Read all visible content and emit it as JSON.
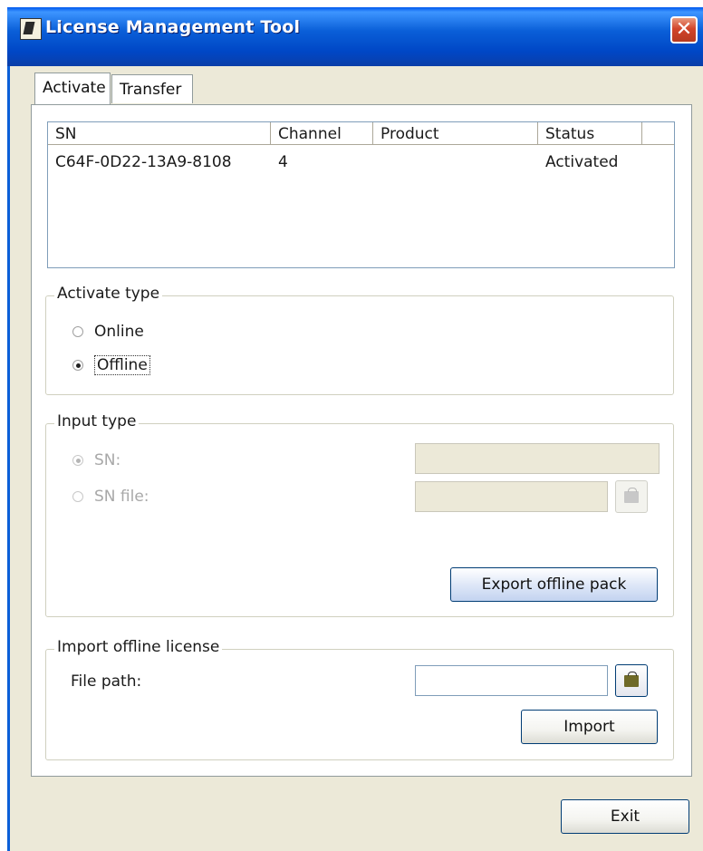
{
  "window": {
    "title": "License Management Tool",
    "close_glyph": "✕"
  },
  "tabs": [
    {
      "label": "Activate",
      "active": true
    },
    {
      "label": "Transfer",
      "active": false
    }
  ],
  "list": {
    "columns": [
      "SN",
      "Channel",
      "Product",
      "Status"
    ],
    "rows": [
      {
        "sn": "C64F-0D22-13A9-8108",
        "channel": "4",
        "product": "",
        "status": "Activated"
      }
    ]
  },
  "activate_type": {
    "label": "Activate type",
    "options": [
      {
        "label": "Online",
        "checked": false
      },
      {
        "label": "Offline",
        "checked": true
      }
    ]
  },
  "input_type": {
    "label": "Input type",
    "sn_label": "SN:",
    "sn_file_label": "SN file:",
    "sn_value": "",
    "sn_file_value": "",
    "export_button": "Export offline pack"
  },
  "import_license": {
    "label": "Import offline license",
    "file_path_label": "File path:",
    "file_path_value": "",
    "import_button": "Import"
  },
  "footer": {
    "exit_button": "Exit"
  },
  "colors": {
    "title_bar": "#0047c6",
    "close_button": "#d2452a",
    "panel": "#ece9d8"
  }
}
